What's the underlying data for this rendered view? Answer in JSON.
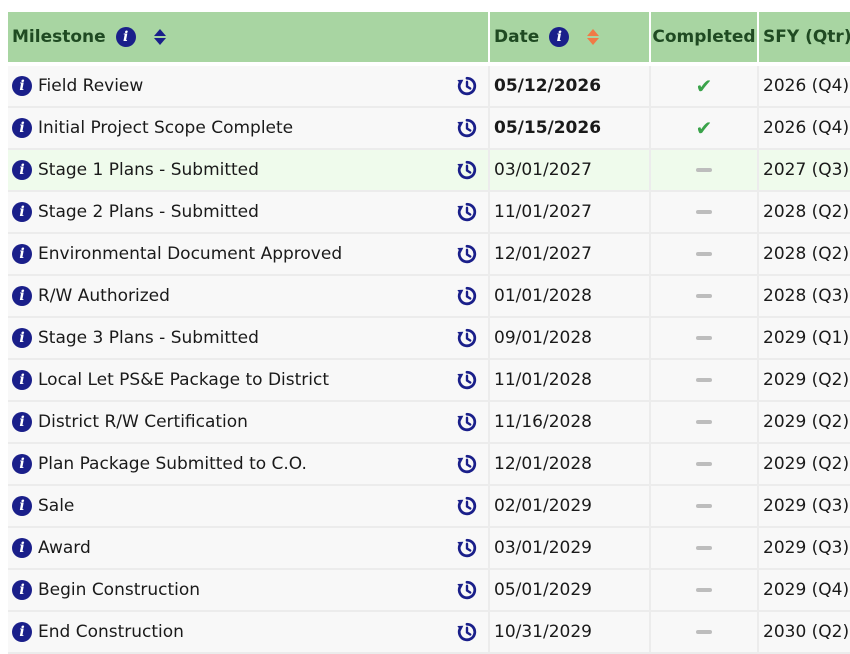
{
  "header": {
    "milestone": "Milestone",
    "date": "Date",
    "completed": "Completed",
    "sfy": "SFY (Qtr)"
  },
  "colors": {
    "header_bg": "#a8d5a2",
    "info_icon": "#1a1f8a",
    "check": "#3aa34a",
    "sort_active": "#f07a46",
    "highlight_row": "#effbec"
  },
  "rows": [
    {
      "milestone": "Field Review",
      "date": "05/12/2026",
      "date_bold": true,
      "completed": "check",
      "sfy": "2026 (Q4)"
    },
    {
      "milestone": "Initial Project Scope Complete",
      "date": "05/15/2026",
      "date_bold": true,
      "completed": "check",
      "sfy": "2026 (Q4)"
    },
    {
      "milestone": "Stage 1 Plans - Submitted",
      "date": "03/01/2027",
      "date_bold": false,
      "completed": "dash",
      "sfy": "2027 (Q3)",
      "highlighted": true
    },
    {
      "milestone": "Stage 2 Plans - Submitted",
      "date": "11/01/2027",
      "date_bold": false,
      "completed": "dash",
      "sfy": "2028 (Q2)"
    },
    {
      "milestone": "Environmental Document Approved",
      "date": "12/01/2027",
      "date_bold": false,
      "completed": "dash",
      "sfy": "2028 (Q2)"
    },
    {
      "milestone": "R/W Authorized",
      "date": "01/01/2028",
      "date_bold": false,
      "completed": "dash",
      "sfy": "2028 (Q3)"
    },
    {
      "milestone": "Stage 3 Plans - Submitted",
      "date": "09/01/2028",
      "date_bold": false,
      "completed": "dash",
      "sfy": "2029 (Q1)"
    },
    {
      "milestone": "Local Let PS&E Package to District",
      "date": "11/01/2028",
      "date_bold": false,
      "completed": "dash",
      "sfy": "2029 (Q2)"
    },
    {
      "milestone": "District R/W Certification",
      "date": "11/16/2028",
      "date_bold": false,
      "completed": "dash",
      "sfy": "2029 (Q2)"
    },
    {
      "milestone": "Plan Package Submitted to C.O.",
      "date": "12/01/2028",
      "date_bold": false,
      "completed": "dash",
      "sfy": "2029 (Q2)"
    },
    {
      "milestone": "Sale",
      "date": "02/01/2029",
      "date_bold": false,
      "completed": "dash",
      "sfy": "2029 (Q3)"
    },
    {
      "milestone": "Award",
      "date": "03/01/2029",
      "date_bold": false,
      "completed": "dash",
      "sfy": "2029 (Q3)"
    },
    {
      "milestone": "Begin Construction",
      "date": "05/01/2029",
      "date_bold": false,
      "completed": "dash",
      "sfy": "2029 (Q4)"
    },
    {
      "milestone": "End Construction",
      "date": "10/31/2029",
      "date_bold": false,
      "completed": "dash",
      "sfy": "2030 (Q2)"
    }
  ]
}
